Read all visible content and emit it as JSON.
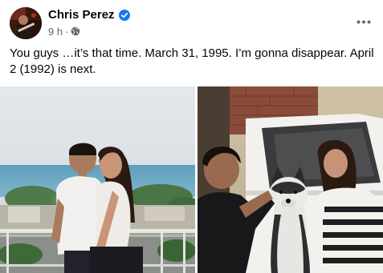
{
  "post": {
    "author": {
      "name": "Chris Perez",
      "verified": true
    },
    "timestamp": "9 h",
    "separator": "·",
    "audience_icon": "globe-icon",
    "more_icon": "more-options-icon",
    "text": "You guys …it’s that time. March 31, 1995. I’m gonna disappear. April 2 (1992) is next.",
    "photos": [
      {
        "name": "photo-couple-balcony"
      },
      {
        "name": "photo-dog-car"
      }
    ]
  },
  "colors": {
    "text_primary": "#050505",
    "text_secondary": "#65676b",
    "verified_blue": "#1877f2",
    "background": "#ffffff"
  }
}
